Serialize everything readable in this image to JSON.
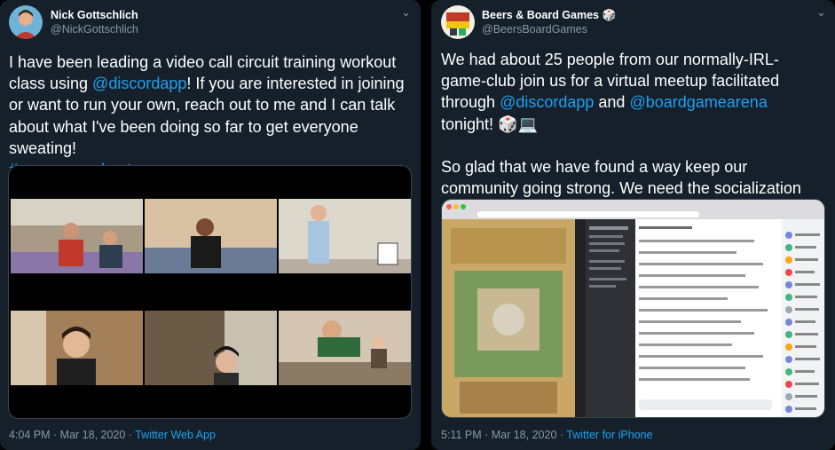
{
  "tweets": [
    {
      "author": "Nick Gottschlich",
      "handle": "@NickGottschlich",
      "text_parts": {
        "p1_a": "I have been leading a video call circuit training workout class using ",
        "p1_link": "@discordapp",
        "p1_b": "! If you are interested in joining or want to run your own, reach out to me and I can talk about what I've been doing so far to get everyone sweating!",
        "hashtag": "#coreonaworkout"
      },
      "timestamp": "4:04 PM · Mar 18, 2020 · ",
      "source": "Twitter Web App"
    },
    {
      "author": "Beers & Board Games",
      "author_emoji": "🎲",
      "handle": "@BeersBoardGames",
      "text_parts": {
        "p1_a": "We had about 25 people from our normally-IRL-game-club join us for a virtual meetup facilitated through ",
        "link1": "@discordapp",
        "and": " and ",
        "link2": "@boardgamearena",
        "p1_b": " tonight! 🎲💻",
        "p2": "So glad that we have found a way keep our community going strong. We need the socialization now more than ever."
      },
      "timestamp": "5:11 PM · Mar 18, 2020 · ",
      "source": "Twitter for iPhone"
    }
  ],
  "icons": {
    "chevron": "chevron-down-icon"
  },
  "colors": {
    "background": "#15202b",
    "link": "#1da1f2",
    "muted": "#8899a6"
  }
}
